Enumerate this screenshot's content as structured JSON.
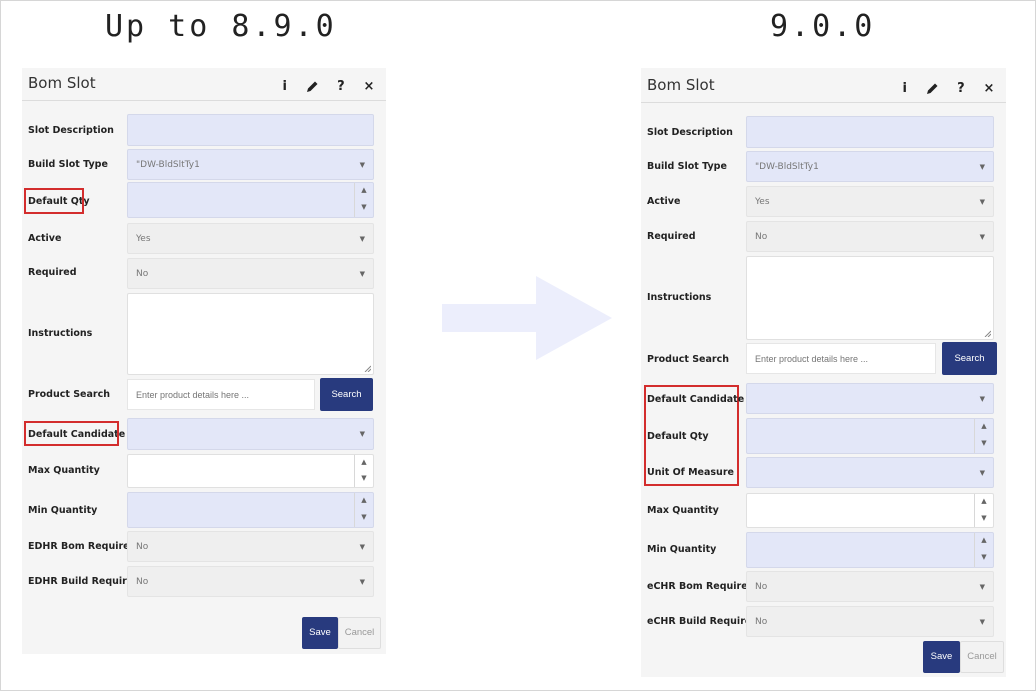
{
  "versions": {
    "before": "Up to 8.9.0",
    "after": "9.0.0"
  },
  "arrow_color": "#eceefc",
  "highlight_color": "#d32d2d",
  "panel": {
    "title": "Bom Slot",
    "header_icons": [
      "info-icon",
      "pencil-icon",
      "help-icon",
      "close-icon"
    ],
    "info_glyph": "i",
    "help_glyph": "?",
    "close_glyph": "×"
  },
  "left": {
    "slot_description": {
      "label": "Slot Description",
      "value": ""
    },
    "build_slot_type": {
      "label": "Build Slot Type",
      "value": "\"DW-BldSltTy1"
    },
    "default_qty": {
      "label": "Default Qty",
      "value": ""
    },
    "active": {
      "label": "Active",
      "value": "Yes"
    },
    "required": {
      "label": "Required",
      "value": "No"
    },
    "instructions": {
      "label": "Instructions",
      "value": ""
    },
    "product_search": {
      "label": "Product Search",
      "placeholder": "Enter product details here ...",
      "button": "Search"
    },
    "default_candidate": {
      "label": "Default Candidate",
      "value": ""
    },
    "max_quantity": {
      "label": "Max Quantity",
      "value": ""
    },
    "min_quantity": {
      "label": "Min Quantity",
      "value": ""
    },
    "edhr_bom_required": {
      "label": "EDHR Bom Required",
      "value": "No"
    },
    "edhr_build_required": {
      "label": "EDHR Build Required",
      "value": "No"
    },
    "save": "Save",
    "cancel": "Cancel"
  },
  "right": {
    "slot_description": {
      "label": "Slot Description",
      "value": ""
    },
    "build_slot_type": {
      "label": "Build Slot Type",
      "value": "\"DW-BldSltTy1"
    },
    "active": {
      "label": "Active",
      "value": "Yes"
    },
    "required": {
      "label": "Required",
      "value": "No"
    },
    "instructions": {
      "label": "Instructions",
      "value": ""
    },
    "product_search": {
      "label": "Product Search",
      "placeholder": "Enter product details here ...",
      "button": "Search"
    },
    "default_candidate": {
      "label": "Default Candidate",
      "value": ""
    },
    "default_qty": {
      "label": "Default Qty",
      "value": ""
    },
    "unit_of_measure": {
      "label": "Unit Of Measure",
      "value": ""
    },
    "max_quantity": {
      "label": "Max Quantity",
      "value": ""
    },
    "min_quantity": {
      "label": "Min Quantity",
      "value": ""
    },
    "echr_bom_required": {
      "label": "eCHR Bom Required",
      "value": "No"
    },
    "echr_build_required": {
      "label": "eCHR Build Required",
      "value": "No"
    },
    "save": "Save",
    "cancel": "Cancel"
  }
}
